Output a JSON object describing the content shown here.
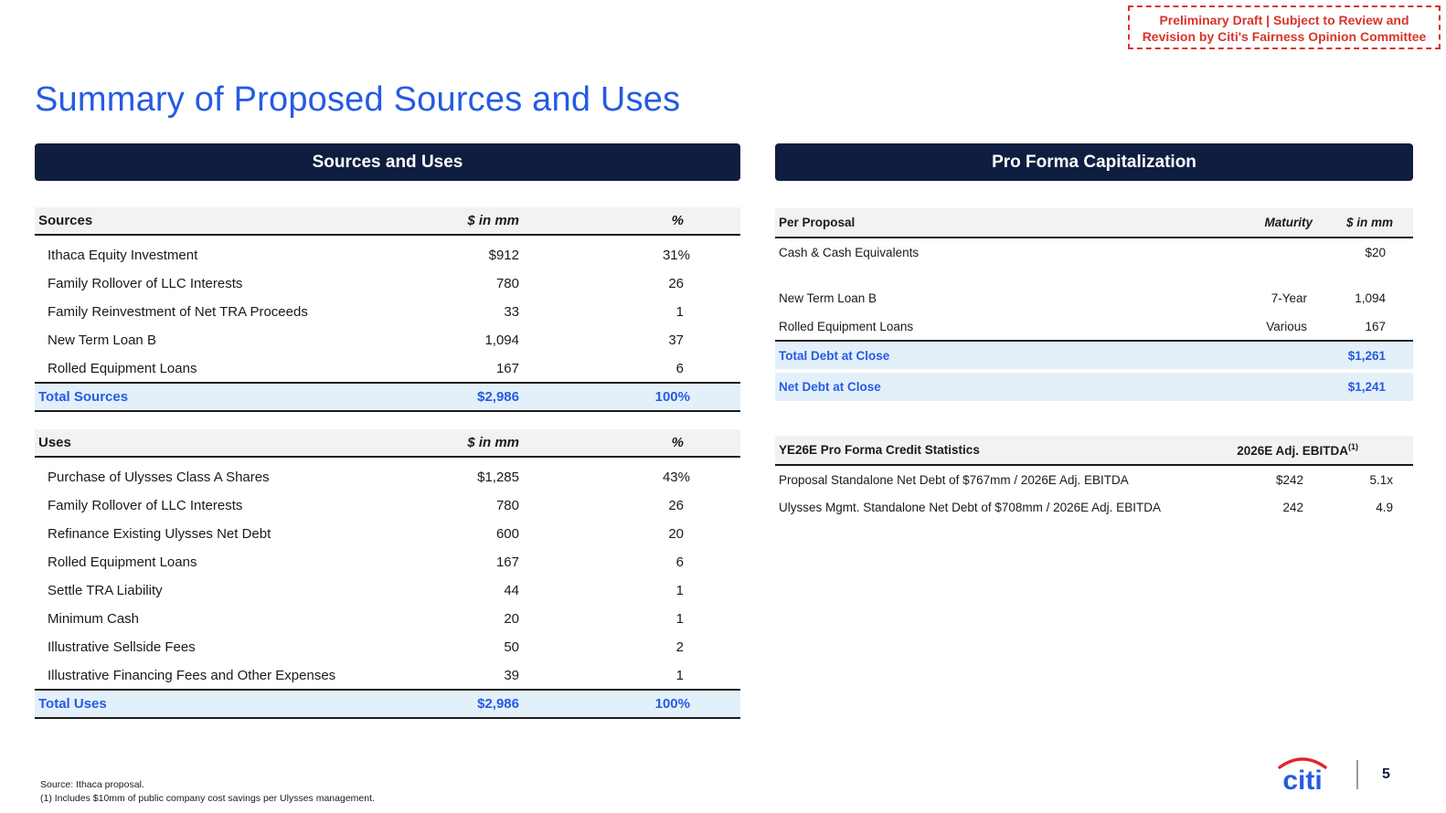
{
  "draft_notice": {
    "line1": "Preliminary Draft | Subject to Review and",
    "line2": "Revision by Citi's Fairness Opinion Committee"
  },
  "title": "Summary of Proposed Sources and Uses",
  "banners": {
    "left": "Sources and Uses",
    "right": "Pro Forma Capitalization"
  },
  "sources": {
    "headers": [
      "Sources",
      "$ in mm",
      "%"
    ],
    "rows": [
      [
        "Ithaca Equity Investment",
        "$912",
        "31%"
      ],
      [
        "Family Rollover of LLC Interests",
        "780",
        "26"
      ],
      [
        "Family Reinvestment of Net TRA Proceeds",
        "33",
        "1"
      ],
      [
        "New Term Loan B",
        "1,094",
        "37"
      ],
      [
        "Rolled Equipment Loans",
        "167",
        "6"
      ]
    ],
    "total": [
      "Total Sources",
      "$2,986",
      "100%"
    ]
  },
  "uses": {
    "headers": [
      "Uses",
      "$ in mm",
      "%"
    ],
    "rows": [
      [
        "Purchase of Ulysses Class A Shares",
        "$1,285",
        "43%"
      ],
      [
        "Family Rollover of LLC Interests",
        "780",
        "26"
      ],
      [
        "Refinance Existing Ulysses Net Debt",
        "600",
        "20"
      ],
      [
        "Rolled Equipment Loans",
        "167",
        "6"
      ],
      [
        "Settle TRA Liability",
        "44",
        "1"
      ],
      [
        "Minimum Cash",
        "20",
        "1"
      ],
      [
        "Illustrative Sellside Fees",
        "50",
        "2"
      ],
      [
        "Illustrative Financing Fees and Other Expenses",
        "39",
        "1"
      ]
    ],
    "total": [
      "Total Uses",
      "$2,986",
      "100%"
    ]
  },
  "pro_forma": {
    "headers": [
      "Per Proposal",
      "Maturity",
      "$ in mm"
    ],
    "cash_row": [
      "Cash & Cash Equivalents",
      "",
      "$20"
    ],
    "debt_rows": [
      [
        "New Term Loan B",
        "7-Year",
        "1,094"
      ],
      [
        "Rolled Equipment Loans",
        "Various",
        "167"
      ]
    ],
    "total_debt": [
      "Total Debt at Close",
      "",
      "$1,261"
    ],
    "net_debt": [
      "Net Debt at Close",
      "",
      "$1,241"
    ]
  },
  "credit_stats": {
    "headers": [
      "YE26E Pro Forma Credit Statistics",
      "2026E Adj. EBITDA",
      "(1)"
    ],
    "rows": [
      [
        "Proposal Standalone Net Debt of $767mm / 2026E Adj. EBITDA",
        "$242",
        "5.1x"
      ],
      [
        "Ulysses Mgmt. Standalone Net Debt of $708mm / 2026E Adj. EBITDA",
        "242",
        "4.9"
      ]
    ]
  },
  "footnotes": {
    "source": "Source: Ithaca proposal.",
    "note1": "(1) Includes $10mm of public company cost savings per Ulysses management."
  },
  "logo_text": "citi",
  "page_number": "5",
  "colors": {
    "title_blue": "#255be3",
    "navy": "#0f1d40",
    "highlight": "#e3f0fa",
    "draft_red": "#d9342b"
  }
}
